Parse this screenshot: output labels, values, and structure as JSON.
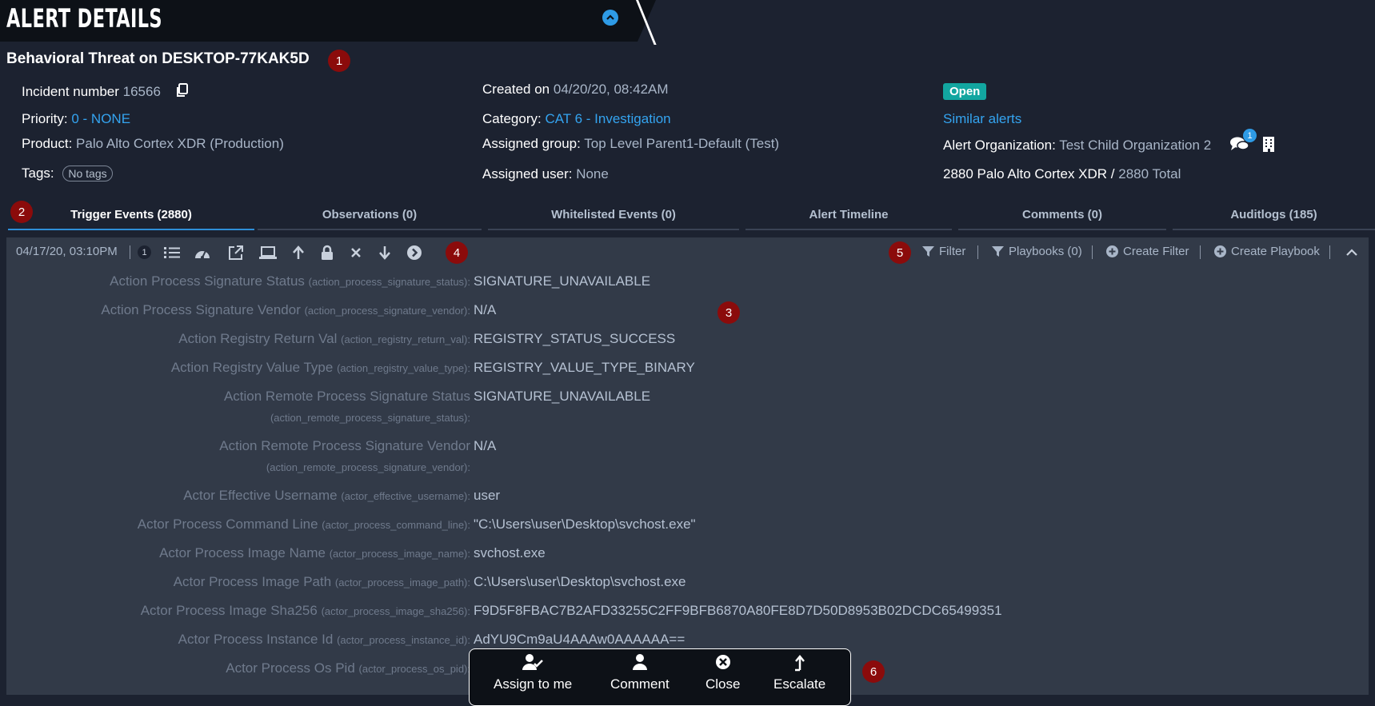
{
  "header": {
    "title": "ALERT DETAILS",
    "alert_name": "Behavioral Threat on DESKTOP-77KAK5D"
  },
  "markers": [
    "1",
    "2",
    "3",
    "4",
    "5",
    "6"
  ],
  "details": {
    "incident_label": "Incident number",
    "incident_value": "16566",
    "priority_label": "Priority:",
    "priority_value": "0 - NONE",
    "product_label": "Product:",
    "product_value": "Palo Alto Cortex XDR (Production)",
    "tags_label": "Tags:",
    "tags_value": "No tags",
    "created_label": "Created on",
    "created_value": "04/20/20, 08:42AM",
    "category_label": "Category:",
    "category_value": "CAT 6 - Investigation",
    "group_label": "Assigned group:",
    "group_value": "Top Level Parent1-Default (Test)",
    "user_label": "Assigned user:",
    "user_value": "None",
    "status": "Open",
    "similar_alerts": "Similar alerts",
    "org_label": "Alert Organization:",
    "org_value": "Test Child Organization 2",
    "chat_count": "1",
    "count_primary": "2880 Palo Alto Cortex XDR /",
    "count_total": "2880 Total"
  },
  "tabs": [
    {
      "label": "Trigger Events (2880)",
      "active": true
    },
    {
      "label": "Observations (0)"
    },
    {
      "label": "Whitelisted Events (0)"
    },
    {
      "label": "Alert Timeline"
    },
    {
      "label": "Comments (0)"
    },
    {
      "label": "Auditlogs (185)"
    }
  ],
  "toolbar": {
    "date": "04/17/20, 03:10PM",
    "count": "1",
    "filter": "Filter",
    "playbooks": "Playbooks (0)",
    "create_filter": "Create Filter",
    "create_playbook": "Create Playbook"
  },
  "fields": [
    {
      "label": "Action Process Signature Status",
      "key": "(action_process_signature_status):",
      "value": "SIGNATURE_UNAVAILABLE"
    },
    {
      "label": "Action Process Signature Vendor",
      "key": "(action_process_signature_vendor):",
      "value": "N/A"
    },
    {
      "label": "Action Registry Return Val",
      "key": "(action_registry_return_val):",
      "value": "REGISTRY_STATUS_SUCCESS"
    },
    {
      "label": "Action Registry Value Type",
      "key": "(action_registry_value_type):",
      "value": "REGISTRY_VALUE_TYPE_BINARY"
    },
    {
      "label": "Action Remote Process Signature Status",
      "key": "(action_remote_process_signature_status):",
      "value": "SIGNATURE_UNAVAILABLE"
    },
    {
      "label": "Action Remote Process Signature Vendor",
      "key": "(action_remote_process_signature_vendor):",
      "value": "N/A"
    },
    {
      "label": "Actor Effective Username",
      "key": "(actor_effective_username):",
      "value": "user"
    },
    {
      "label": "Actor Process Command Line",
      "key": "(actor_process_command_line):",
      "value": "\"C:\\Users\\user\\Desktop\\svchost.exe\""
    },
    {
      "label": "Actor Process Image Name",
      "key": "(actor_process_image_name):",
      "value": "svchost.exe"
    },
    {
      "label": "Actor Process Image Path",
      "key": "(actor_process_image_path):",
      "value": "C:\\Users\\user\\Desktop\\svchost.exe"
    },
    {
      "label": "Actor Process Image Sha256",
      "key": "(actor_process_image_sha256):",
      "value": "F9D5F8FBAC7B2AFD33255C2FF9BFB6870A80FE8D7D50D8953B02DCDC65499351"
    },
    {
      "label": "Actor Process Instance Id",
      "key": "(actor_process_instance_id):",
      "value": "AdYU9Cm9aU4AAAw0AAAAAA=="
    },
    {
      "label": "Actor Process Os Pid",
      "key": "(actor_process_os_pid):",
      "value": ""
    }
  ],
  "actions": {
    "assign": "Assign to me",
    "comment": "Comment",
    "close": "Close",
    "escalate": "Escalate"
  },
  "colors": {
    "accent": "#34a4f0",
    "marker": "#8b0b0b",
    "open_badge": "#12a6a0"
  }
}
